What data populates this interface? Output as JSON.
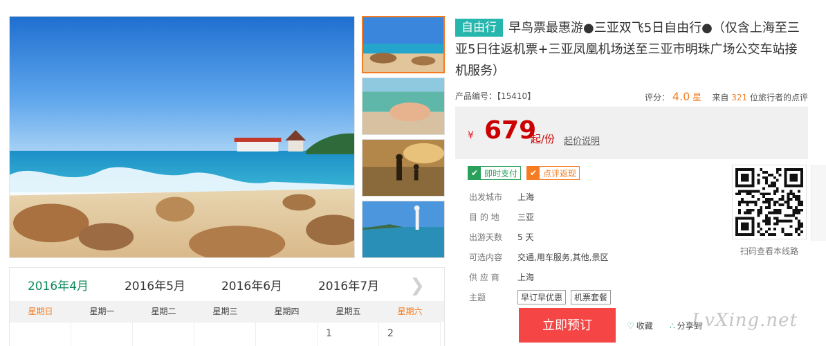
{
  "gallery": {
    "main_photo": "sanya-beach-pavilion-photo",
    "thumbnails": [
      "beach-rocks-thumb",
      "hand-with-sand-thumb",
      "sunset-silhouettes-thumb",
      "guanyin-statue-coast-thumb"
    ]
  },
  "calendar": {
    "months": [
      "2016年4月",
      "2016年5月",
      "2016年6月",
      "2016年7月"
    ],
    "active_month": "2016年4月",
    "next_icon": "chevron-right-icon",
    "weekdays": [
      "星期日",
      "星期一",
      "星期二",
      "星期三",
      "星期四",
      "星期五",
      "星期六"
    ],
    "first_row_days": [
      "",
      "",
      "",
      "",
      "",
      "1",
      "2"
    ]
  },
  "product": {
    "tag": "自由行",
    "title": "早鸟票最惠游●三亚双飞5日自由行●（仅含上海至三亚5日往返机票+三亚凤凰机场送至三亚市明珠广场公交车站接机服务）",
    "code_label": "产品编号：",
    "code": "【15410】",
    "rating_label": "评分：",
    "rating": "4.0",
    "rating_unit": "星",
    "review_prefix": "来自",
    "review_count": "321",
    "review_suffix": "位旅行者的点评"
  },
  "price": {
    "currency": "¥",
    "amount": "679",
    "unit": "起/份",
    "note": "起价说明"
  },
  "badges": [
    {
      "label": "即时支付",
      "color": "#2aa15a"
    },
    {
      "label": "点评返现",
      "color": "#f57c22"
    }
  ],
  "info": {
    "departure_label": "出发城市",
    "departure": "上海",
    "destination_label": "目 的 地",
    "destination": "三亚",
    "days_label": "出游天数",
    "days": "5 天",
    "options_label": "可选内容",
    "options": "交通,用车服务,其他,景区",
    "supplier_label": "供 应 商",
    "supplier": "上海",
    "theme_label": "主题",
    "themes": [
      "早订早优惠",
      "机票套餐"
    ]
  },
  "qr": {
    "caption": "扫码查看本线路"
  },
  "actions": {
    "book": "立即预订",
    "favorite": "收藏",
    "share": "分享到"
  },
  "watermark": "LvXing.net",
  "colors": {
    "accent_orange": "#f57c22",
    "price_red": "#cc0000",
    "book_red": "#f54545",
    "tag_teal": "#25b6ad",
    "green": "#2aa15a"
  }
}
